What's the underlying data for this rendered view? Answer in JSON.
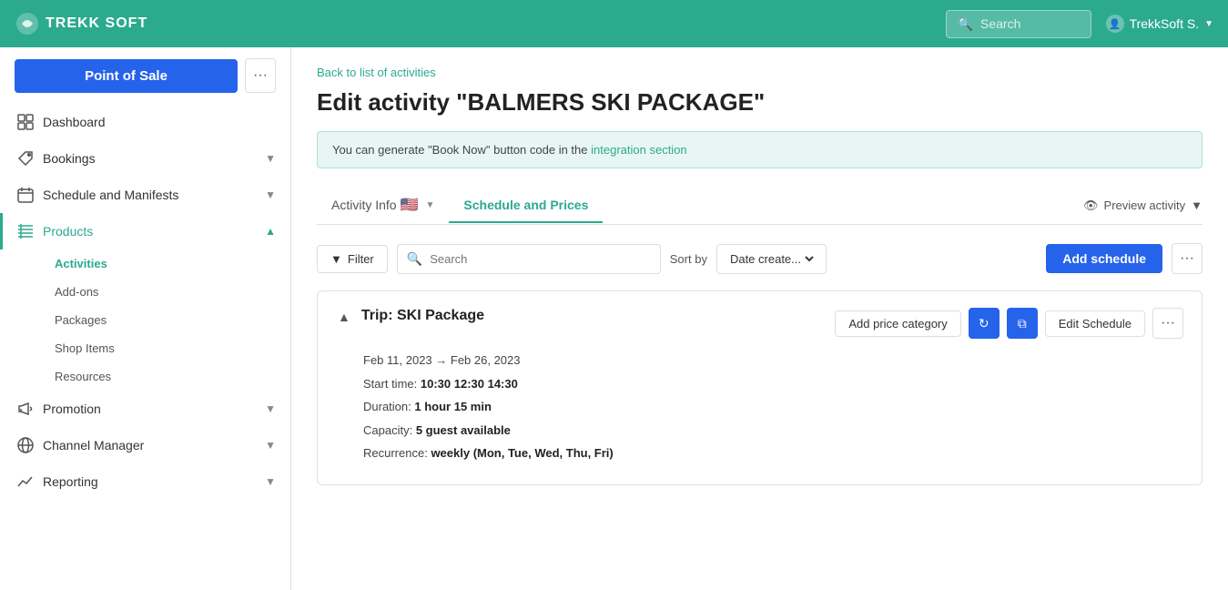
{
  "topnav": {
    "logo_text": "TREKK SOFT",
    "search_placeholder": "Search",
    "user_label": "TrekkSoft S.",
    "search_icon": "🔍"
  },
  "sidebar": {
    "pos_btn_label": "Point of Sale",
    "pos_more_icon": "···",
    "nav_items": [
      {
        "id": "dashboard",
        "label": "Dashboard",
        "icon": "grid",
        "has_children": false
      },
      {
        "id": "bookings",
        "label": "Bookings",
        "icon": "tag",
        "has_children": true
      },
      {
        "id": "schedule",
        "label": "Schedule and Manifests",
        "icon": "calendar",
        "has_children": true
      },
      {
        "id": "products",
        "label": "Products",
        "icon": "list",
        "has_children": true,
        "active": true
      },
      {
        "id": "promotion",
        "label": "Promotion",
        "icon": "megaphone",
        "has_children": true
      },
      {
        "id": "channel",
        "label": "Channel Manager",
        "icon": "globe",
        "has_children": true
      },
      {
        "id": "reporting",
        "label": "Reporting",
        "icon": "chart",
        "has_children": true
      }
    ],
    "products_sub_items": [
      {
        "id": "activities",
        "label": "Activities",
        "active": true
      },
      {
        "id": "addons",
        "label": "Add-ons"
      },
      {
        "id": "packages",
        "label": "Packages"
      },
      {
        "id": "shop-items",
        "label": "Shop Items"
      },
      {
        "id": "resources",
        "label": "Resources"
      }
    ]
  },
  "content": {
    "breadcrumb": "Back to list of activities",
    "page_title": "Edit activity \"BALMERS SKI PACKAGE\"",
    "info_banner": {
      "text_before": "You can generate \"Book Now\" button code in the",
      "link_text": "integration section",
      "text_after": ""
    },
    "tabs": [
      {
        "id": "activity-info",
        "label": "Activity Info",
        "active": false,
        "has_flag": true
      },
      {
        "id": "schedule-prices",
        "label": "Schedule and Prices",
        "active": true
      }
    ],
    "preview_btn_label": "Preview activity",
    "filter": {
      "filter_btn_label": "Filter",
      "search_placeholder": "Search",
      "sort_label": "Sort by",
      "sort_value": "Date create...",
      "add_schedule_label": "Add schedule"
    },
    "schedule": {
      "title": "Trip: SKI Package",
      "date_range": "Feb 11, 2023 → Feb 26, 2023",
      "start_time_label": "Start time:",
      "start_time_value": "10:30  12:30  14:30",
      "duration_label": "Duration:",
      "duration_value": "1 hour 15 min",
      "capacity_label": "Capacity:",
      "capacity_value": "5 guest available",
      "recurrence_label": "Recurrence:",
      "recurrence_value": "weekly (Mon, Tue, Wed, Thu, Fri)",
      "add_price_category_label": "Add price category",
      "edit_schedule_label": "Edit Schedule"
    }
  }
}
